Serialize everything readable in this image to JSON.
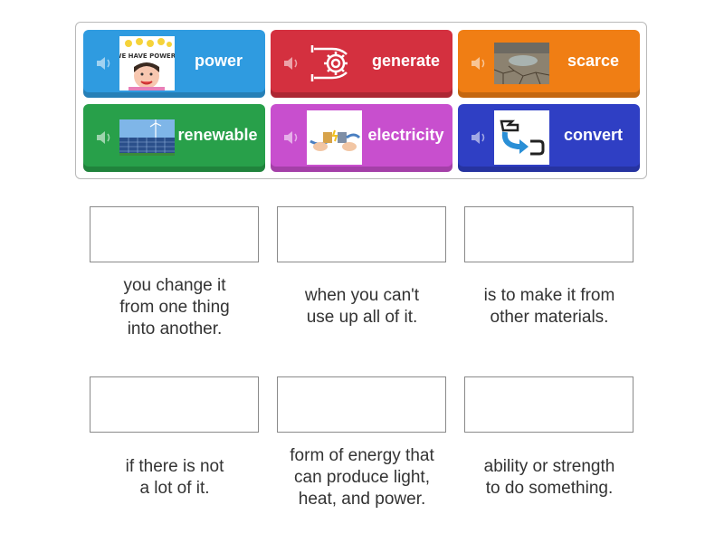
{
  "tiles": [
    {
      "word": "power",
      "color": "#2f9be0",
      "image": "we-have-power-cartoon"
    },
    {
      "word": "generate",
      "color": "#d4303f",
      "image": "gear-in-hands-icon"
    },
    {
      "word": "scarce",
      "color": "#f07e14",
      "image": "cracked-dry-earth"
    },
    {
      "word": "renewable",
      "color": "#28a04a",
      "image": "solar-panels-wind-turbine"
    },
    {
      "word": "electricity",
      "color": "#c84fce",
      "image": "electric-plug-connection"
    },
    {
      "word": "convert",
      "color": "#2f3fc4",
      "image": "convert-arrow-icon"
    }
  ],
  "poster_text": "WE HAVE POWER!",
  "definitions": [
    {
      "text": "you change it\nfrom one thing\ninto another."
    },
    {
      "text": "when you can't\nuse up all of it."
    },
    {
      "text": "is to make it from\nother materials."
    },
    {
      "text": "if there is not\na lot of it."
    },
    {
      "text": "form of energy that\ncan produce light,\nheat, and power."
    },
    {
      "text": "ability or strength\nto do something."
    }
  ]
}
